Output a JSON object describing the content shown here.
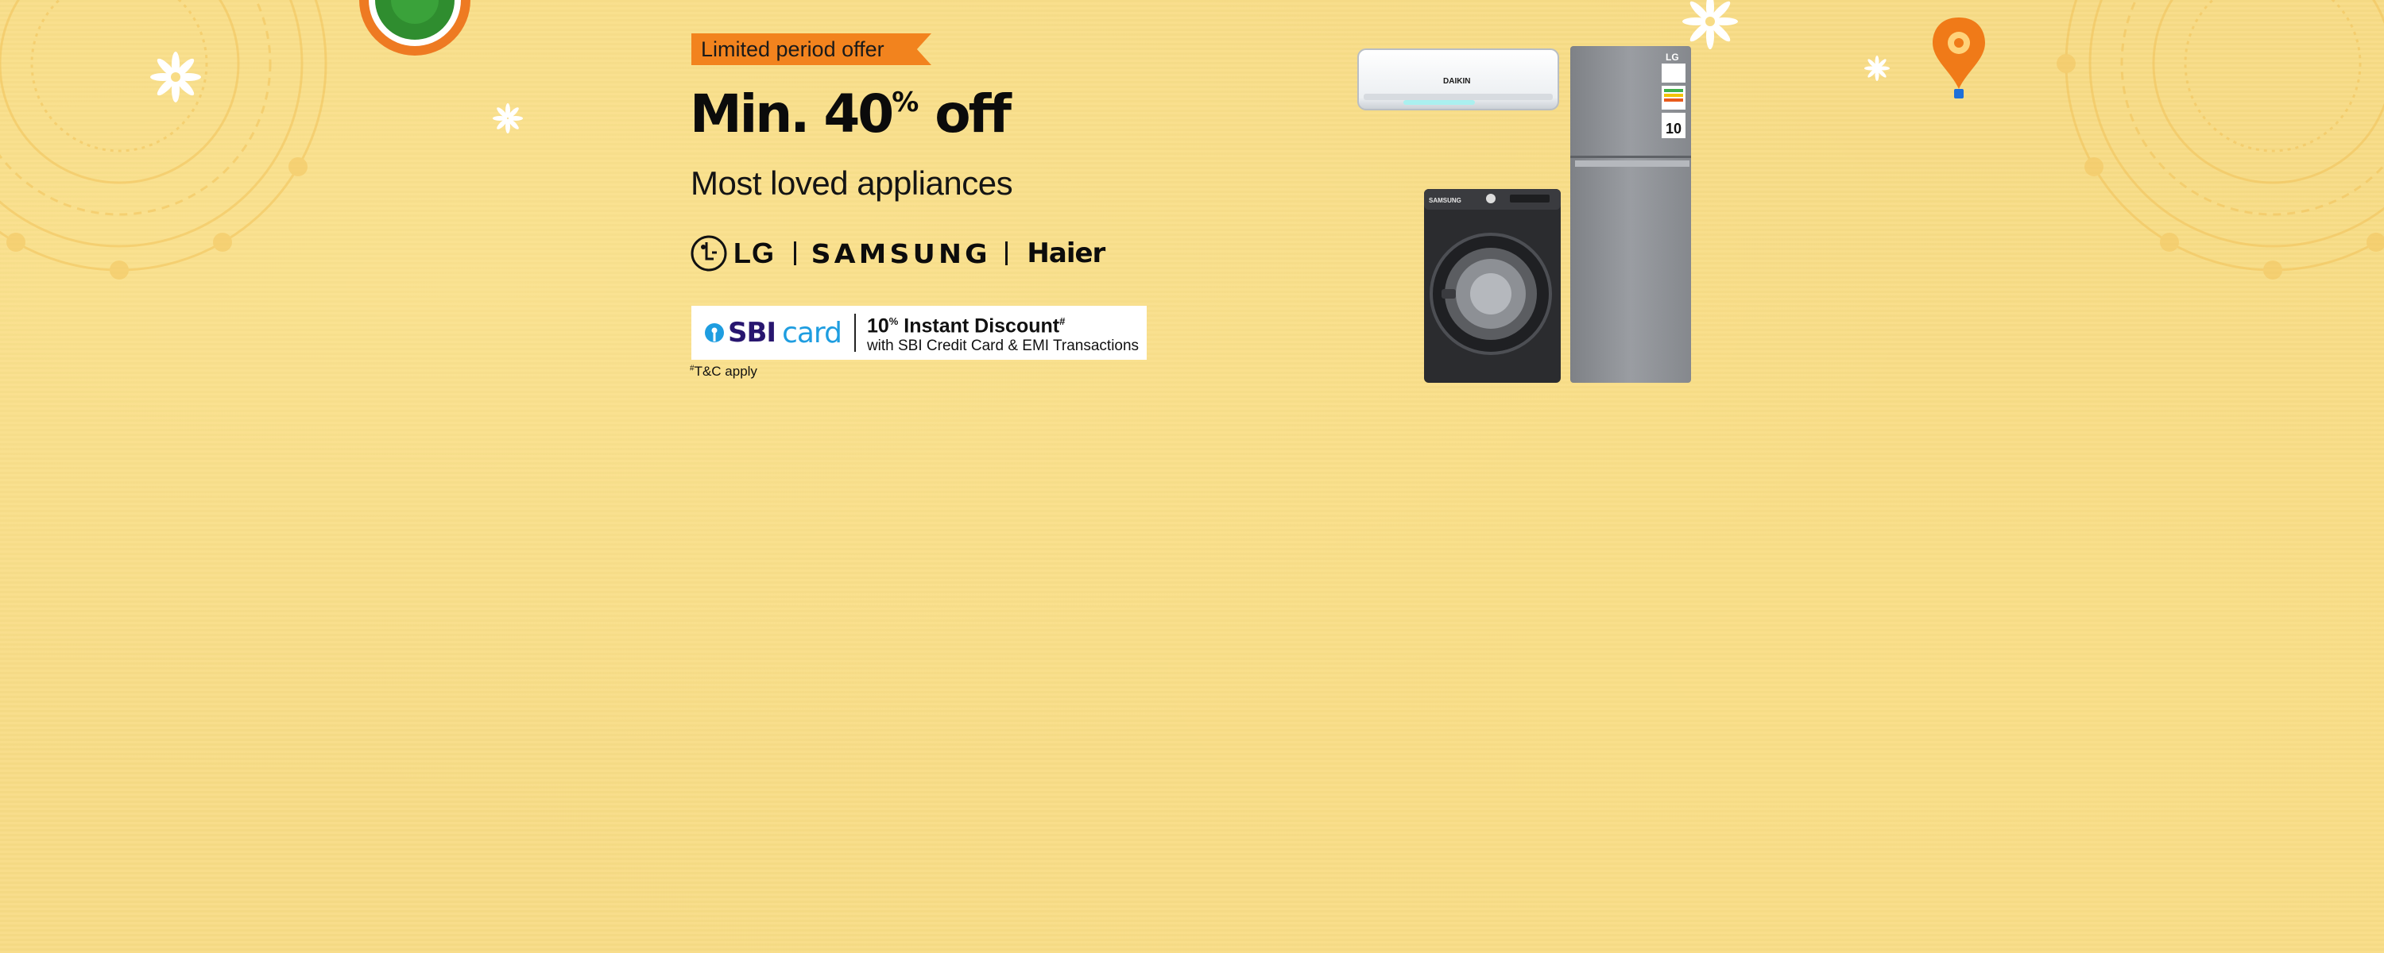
{
  "banner": {
    "ribbon": "Limited period offer",
    "headline": {
      "prefix": "Min. 40",
      "superscript": "%",
      "suffix": " off"
    },
    "subheadline": "Most loved appliances",
    "brands": {
      "lg": "LG",
      "samsung": "SAMSUNG",
      "haier": "Haier"
    },
    "bank_offer": {
      "logo_bank": "SBI",
      "logo_card": "card",
      "discount_value": "10",
      "discount_unit": "%",
      "discount_text": " Instant Discount",
      "discount_mark": "#",
      "detail": "with SBI Credit Card & EMI Transactions"
    },
    "terms": {
      "mark": "#",
      "text": "T&C apply"
    },
    "products": {
      "ac_brand": "DAIKIN",
      "washer_brand": "SAMSUNG",
      "fridge_brand": "LG",
      "fridge_rating": "10"
    },
    "colors": {
      "background": "#f8dc86",
      "ribbon": "#f2831e",
      "sbi_blue": "#28166f",
      "card_blue": "#1e9de0"
    },
    "icons": [
      "mandala-icon",
      "flower-icon",
      "kite-icon",
      "lg-logo-icon",
      "sbi-key-icon"
    ]
  }
}
